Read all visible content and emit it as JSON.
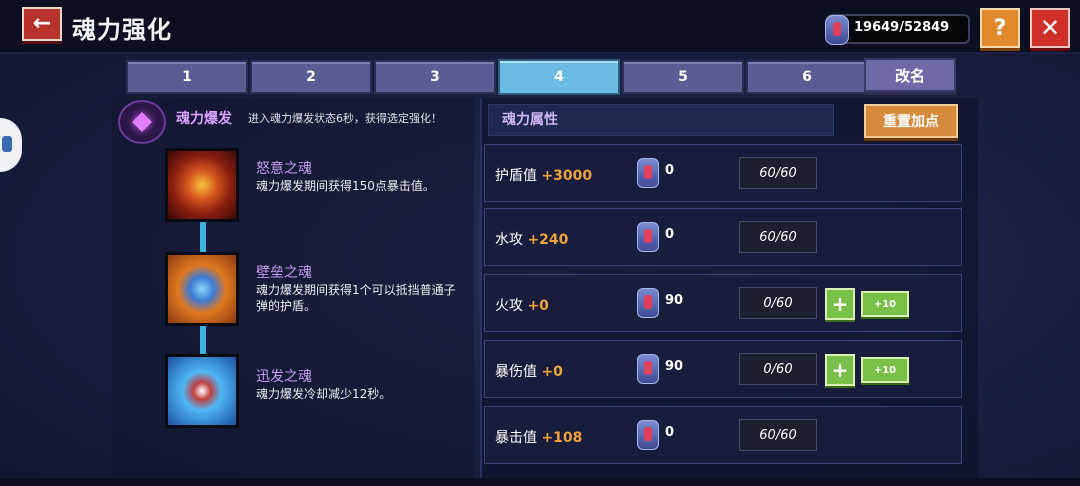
{
  "header": {
    "title": "魂力强化",
    "currency": "19649/52849"
  },
  "tabs": [
    "1",
    "2",
    "3",
    "4",
    "5",
    "6"
  ],
  "active_tab": "4",
  "rename_label": "改名",
  "burst": {
    "name": "魂力爆发",
    "desc": "进入魂力爆发状态6秒，获得选定强化！"
  },
  "skills": [
    {
      "name": "怒意之魂",
      "desc": "魂力爆发期间获得150点暴击值。",
      "icon": "rage-soul-icon"
    },
    {
      "name": "壁垒之魂",
      "desc": "魂力爆发期间获得1个可以抵挡普通子弹的护盾。",
      "icon": "wall-soul-icon"
    },
    {
      "name": "迅发之魂",
      "desc": "魂力爆发冷却减少12秒。",
      "icon": "swift-soul-icon"
    }
  ],
  "attributes": {
    "title": "魂力属性",
    "reset_label": "重置加点",
    "rows": [
      {
        "name": "护盾值",
        "bonus": "+3000",
        "cost": "0",
        "level": "60/60",
        "upgradable": false
      },
      {
        "name": "水攻",
        "bonus": "+240",
        "cost": "0",
        "level": "60/60",
        "upgradable": false
      },
      {
        "name": "火攻",
        "bonus": "+0",
        "cost": "90",
        "level": "0/60",
        "upgradable": true,
        "plus_label": "+",
        "plus10_label": "+10"
      },
      {
        "name": "暴伤值",
        "bonus": "+0",
        "cost": "90",
        "level": "0/60",
        "upgradable": true,
        "plus_label": "+",
        "plus10_label": "+10"
      },
      {
        "name": "暴击值",
        "bonus": "+108",
        "cost": "0",
        "level": "60/60",
        "upgradable": false
      }
    ]
  },
  "colors": {
    "active_tab": "#6cbbe4",
    "tab": "#5a5c93",
    "bonus": "#f0a23a",
    "close": "#d0302c",
    "help": "#e08a2c",
    "reset": "#d68a3c",
    "plus": "#7ac048"
  },
  "icons": {
    "back": "back-arrow-icon",
    "help": "question-icon",
    "close": "close-icon",
    "currency": "soul-crystal-icon",
    "burst": "soul-burst-icon"
  }
}
